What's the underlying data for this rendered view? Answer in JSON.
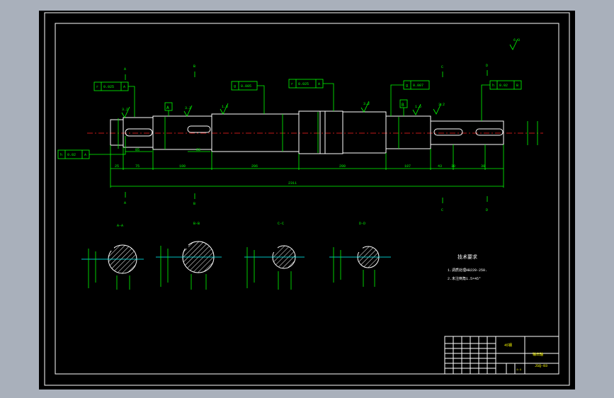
{
  "drawing": {
    "section_markers": {
      "a": "A",
      "b": "B",
      "c": "C",
      "d": "D"
    },
    "section_titles": [
      "A-A",
      "B-B",
      "C-C",
      "D-D"
    ],
    "tolerance_frames": {
      "runout_1": {
        "symbol": "r",
        "value": "0.025",
        "datum": "A"
      },
      "cyl_1": {
        "symbol": "g",
        "value": "0.005"
      },
      "runout_2": {
        "symbol": "r",
        "value": "0.025",
        "datum": "A"
      },
      "cyl_2": {
        "symbol": "g",
        "value": "0.007"
      },
      "sym_left": {
        "symbol": "h",
        "value": "0.02",
        "datum": "A"
      },
      "sym_right": {
        "symbol": "h",
        "value": "0.02",
        "datum": "B"
      }
    },
    "datums": {
      "a": "A",
      "b": "B"
    },
    "roughness": {
      "r1": "3.2",
      "r2": "3.2",
      "r3": "1.6",
      "r4": "3.2",
      "r5": "1.6",
      "r6": "3.2",
      "general": "6.3"
    },
    "dimensions": {
      "d1": "25",
      "d2": "75",
      "d3": "100",
      "d4": "206",
      "d5": "200",
      "d6": "107",
      "d7": "43",
      "d8": "30",
      "d9": "30",
      "key1": "85",
      "key2": "85",
      "total": "2311"
    },
    "notes": {
      "title": "技术要求",
      "line1": "1.调质处理HB220-250.",
      "line2": "2.未注倒角1.5×45°"
    }
  },
  "title_block": {
    "part_name": "输出轴",
    "material": "45钢",
    "drawing_no": "JSQ-03",
    "scale": "1:1"
  }
}
